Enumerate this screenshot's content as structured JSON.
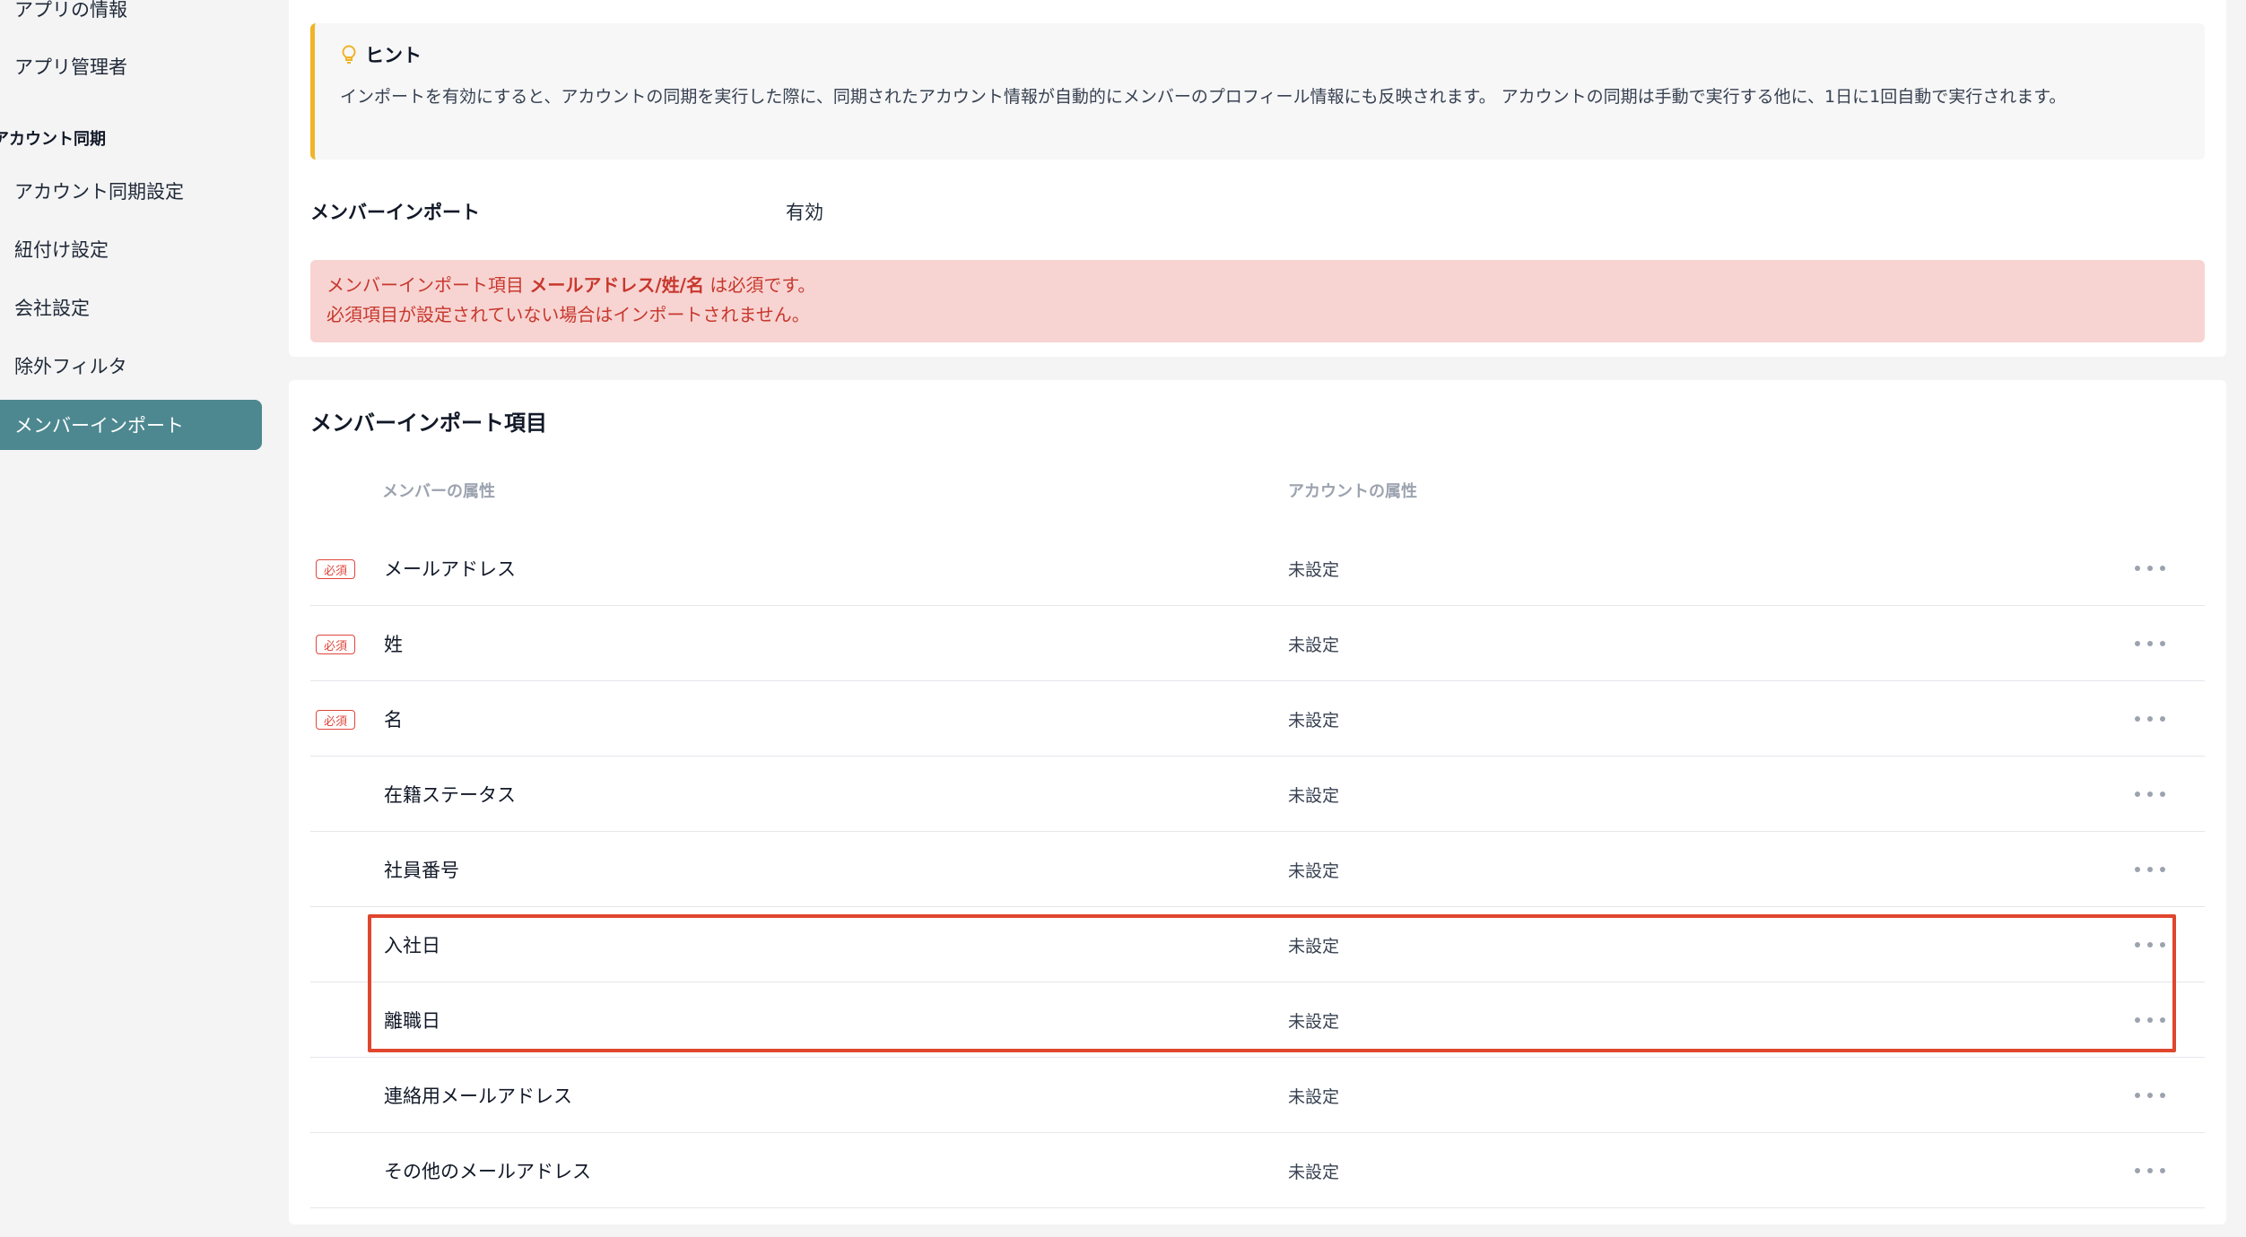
{
  "sidebar": {
    "items_top": [
      {
        "label": "アプリの情報"
      },
      {
        "label": "アプリ管理者"
      }
    ],
    "section_label": "アカウント同期",
    "items": [
      {
        "label": "アカウント同期設定"
      },
      {
        "label": "紐付け設定"
      },
      {
        "label": "会社設定"
      },
      {
        "label": "除外フィルタ"
      },
      {
        "label": "メンバーインポート",
        "active": true
      }
    ]
  },
  "hint": {
    "title": "ヒント",
    "icon": "lightbulb-icon",
    "text": "インポートを有効にすると、アカウントの同期を実行した際に、同期されたアカウント情報が自動的にメンバーのプロフィール情報にも反映されます。 アカウントの同期は手動で実行する他に、1日に1回自動で実行されます。"
  },
  "setting": {
    "label": "メンバーインポート",
    "value": "有効"
  },
  "alert": {
    "line1_prefix": "メンバーインポート項目 ",
    "line1_strong": "メールアドレス/姓/名",
    "line1_suffix": " は必須です。",
    "line2": "必須項目が設定されていない場合はインポートされません。"
  },
  "import_items": {
    "title": "メンバーインポート項目",
    "col_member": "メンバーの属性",
    "col_account": "アカウントの属性",
    "required_label": "必須",
    "rows": [
      {
        "name": "メールアドレス",
        "value": "未設定",
        "required": true
      },
      {
        "name": "姓",
        "value": "未設定",
        "required": true
      },
      {
        "name": "名",
        "value": "未設定",
        "required": true
      },
      {
        "name": "在籍ステータス",
        "value": "未設定",
        "required": false
      },
      {
        "name": "社員番号",
        "value": "未設定",
        "required": false
      },
      {
        "name": "入社日",
        "value": "未設定",
        "required": false
      },
      {
        "name": "離職日",
        "value": "未設定",
        "required": false
      },
      {
        "name": "連絡用メールアドレス",
        "value": "未設定",
        "required": false
      },
      {
        "name": "その他のメールアドレス",
        "value": "未設定",
        "required": false
      }
    ]
  },
  "colors": {
    "accent": "#4d8890",
    "hint_border": "#f0b429",
    "alert_bg": "#f7d4d2",
    "alert_text": "#c8372d",
    "highlight": "#e0462e"
  }
}
